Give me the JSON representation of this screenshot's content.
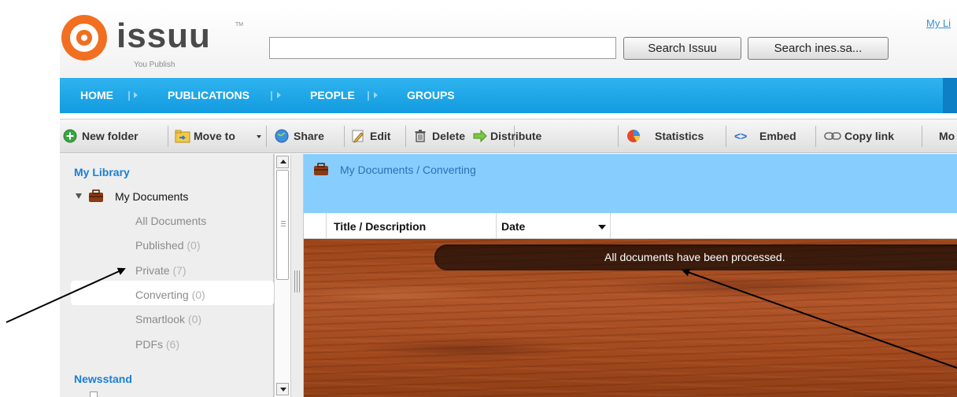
{
  "header": {
    "logo_text": "issuu",
    "logo_tm": "TM",
    "logo_tagline": "You Publish",
    "search_placeholder": "",
    "search_issuu_label": "Search Issuu",
    "search_user_label": "Search ines.sa...",
    "my_library_link": "My Li"
  },
  "nav": {
    "items": [
      {
        "label": "HOME"
      },
      {
        "label": "PUBLICATIONS"
      },
      {
        "label": "PEOPLE"
      },
      {
        "label": "GROUPS"
      }
    ]
  },
  "toolbar": {
    "new_folder": "New folder",
    "move_to": "Move to",
    "share": "Share",
    "edit": "Edit",
    "delete": "Delete",
    "distribute": "Distribute",
    "statistics": "Statistics",
    "embed": "Embed",
    "copy_link": "Copy link",
    "more": "Mo"
  },
  "sidebar": {
    "my_library": "My Library",
    "my_documents": "My Documents",
    "items": [
      {
        "label": "All Documents",
        "count": ""
      },
      {
        "label": "Published",
        "count": "(0)"
      },
      {
        "label": "Private",
        "count": "(7)"
      },
      {
        "label": "Converting",
        "count": "(0)"
      },
      {
        "label": "Smartlook",
        "count": "(0)"
      },
      {
        "label": "PDFs",
        "count": "(6)"
      }
    ],
    "newsstand": "Newsstand"
  },
  "main": {
    "path": "My Documents / Converting",
    "columns": [
      {
        "label": "Title / Description"
      },
      {
        "label": "Date"
      }
    ],
    "status_message": "All documents have been processed."
  },
  "colors": {
    "brand_orange": "#f26f21",
    "nav_blue": "#1aa6e8",
    "path_bar_blue": "#87ceff",
    "link_blue": "#1a7fd1"
  }
}
